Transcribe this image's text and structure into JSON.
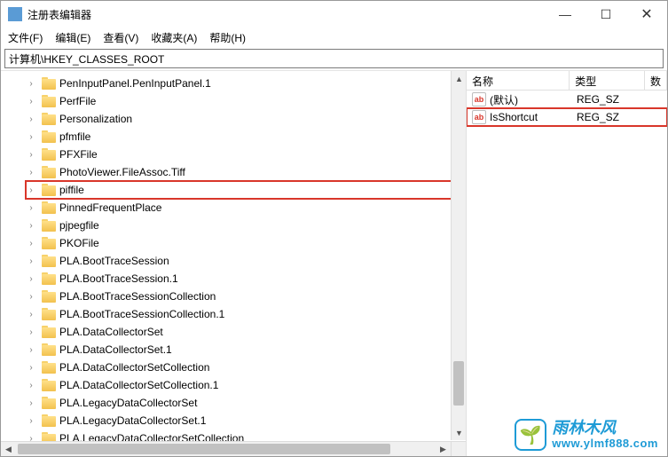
{
  "window": {
    "title": "注册表编辑器"
  },
  "menu": {
    "file": "文件(F)",
    "edit": "编辑(E)",
    "view": "查看(V)",
    "favorites": "收藏夹(A)",
    "help": "帮助(H)"
  },
  "address": "计算机\\HKEY_CLASSES_ROOT",
  "tree": {
    "items": [
      {
        "label": "PenInputPanel.PenInputPanel.1",
        "highlighted": false
      },
      {
        "label": "PerfFile",
        "highlighted": false
      },
      {
        "label": "Personalization",
        "highlighted": false
      },
      {
        "label": "pfmfile",
        "highlighted": false
      },
      {
        "label": "PFXFile",
        "highlighted": false
      },
      {
        "label": "PhotoViewer.FileAssoc.Tiff",
        "highlighted": false
      },
      {
        "label": "piffile",
        "highlighted": true
      },
      {
        "label": "PinnedFrequentPlace",
        "highlighted": false
      },
      {
        "label": "pjpegfile",
        "highlighted": false
      },
      {
        "label": "PKOFile",
        "highlighted": false
      },
      {
        "label": "PLA.BootTraceSession",
        "highlighted": false
      },
      {
        "label": "PLA.BootTraceSession.1",
        "highlighted": false
      },
      {
        "label": "PLA.BootTraceSessionCollection",
        "highlighted": false
      },
      {
        "label": "PLA.BootTraceSessionCollection.1",
        "highlighted": false
      },
      {
        "label": "PLA.DataCollectorSet",
        "highlighted": false
      },
      {
        "label": "PLA.DataCollectorSet.1",
        "highlighted": false
      },
      {
        "label": "PLA.DataCollectorSetCollection",
        "highlighted": false
      },
      {
        "label": "PLA.DataCollectorSetCollection.1",
        "highlighted": false
      },
      {
        "label": "PLA.LegacyDataCollectorSet",
        "highlighted": false
      },
      {
        "label": "PLA.LegacyDataCollectorSet.1",
        "highlighted": false
      },
      {
        "label": "PLA.LegacyDataCollectorSetCollection",
        "highlighted": false
      }
    ]
  },
  "list": {
    "columns": {
      "name": "名称",
      "type": "类型",
      "data": "数"
    },
    "rows": [
      {
        "name": "(默认)",
        "type": "REG_SZ",
        "highlighted": false
      },
      {
        "name": "IsShortcut",
        "type": "REG_SZ",
        "highlighted": true
      }
    ]
  },
  "icons": {
    "string_value": "ab"
  },
  "watermark": {
    "cn": "雨林木风",
    "url": "www.ylmf888.com",
    "glyph": "🌱"
  }
}
